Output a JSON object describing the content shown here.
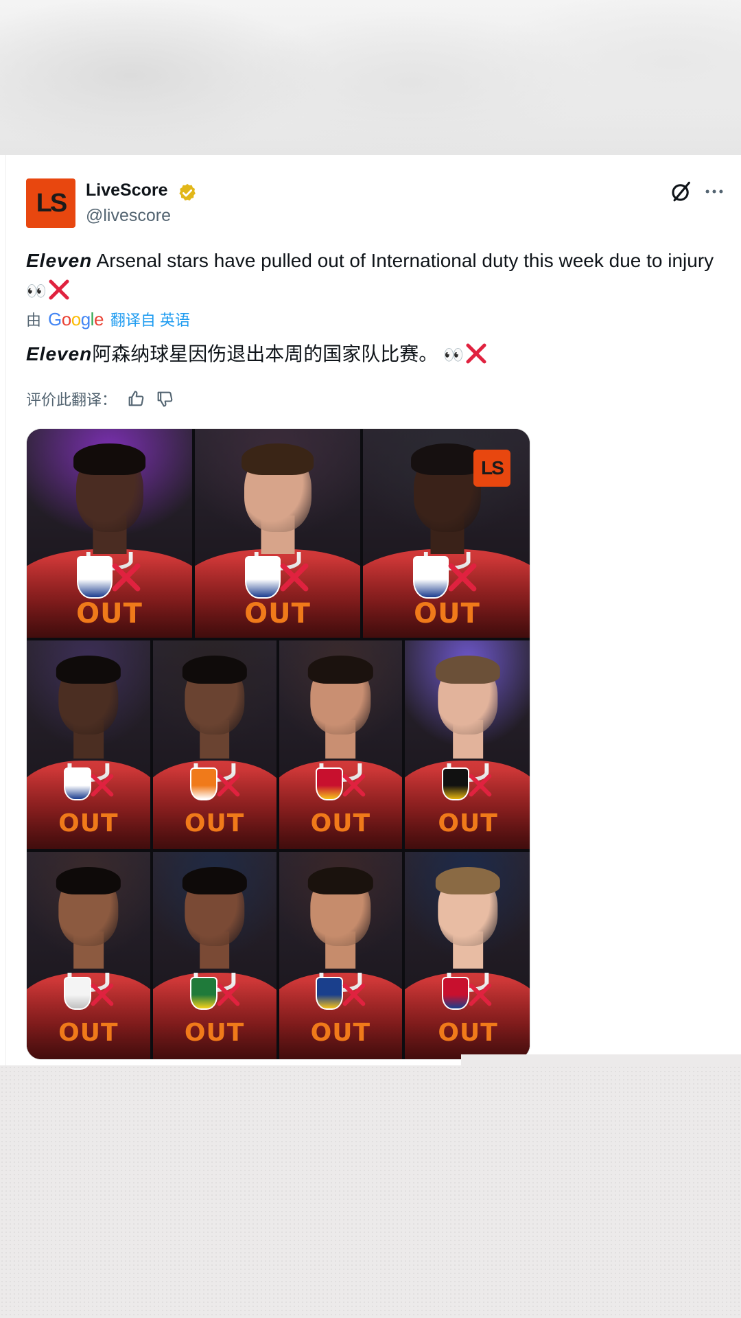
{
  "post": {
    "author": {
      "display_name": "LiveScore",
      "handle": "@livescore",
      "avatar_text": "LS",
      "verified": true
    },
    "text_emphasis": "Eleven",
    "text_body": " Arsenal stars have pulled out of International duty this week due to injury",
    "text_emoji": "👀",
    "translate": {
      "prefix": "由",
      "provider": "Google",
      "link": "翻译自 英语"
    },
    "translated_emphasis": "Eleven",
    "translated_body": "阿森纳球星因伤退出本周的国家队比赛。",
    "translated_emoji": "👀",
    "rate_label": "评价此翻译："
  },
  "media": {
    "logo_text": "LS",
    "rows": [
      [
        {
          "label": "OUT",
          "badge": "england-crest-icon"
        },
        {
          "label": "OUT",
          "badge": "england-crest-icon"
        },
        {
          "label": "OUT",
          "badge": "england-crest-icon"
        }
      ],
      [
        {
          "label": "OUT",
          "badge": "england-crest-icon"
        },
        {
          "label": "OUT",
          "badge": "netherlands-crest-icon"
        },
        {
          "label": "OUT",
          "badge": "spain-crest-icon"
        },
        {
          "label": "OUT",
          "badge": "belgium-crest-icon"
        }
      ],
      [
        {
          "label": "OUT",
          "badge": "france-rooster-icon"
        },
        {
          "label": "OUT",
          "badge": "brazil-crest-icon"
        },
        {
          "label": "OUT",
          "badge": "ecuador-crest-icon"
        },
        {
          "label": "OUT",
          "badge": "norway-crest-icon"
        }
      ]
    ]
  },
  "colors": {
    "accent": "#e8470f",
    "out_label": "#f07a1a",
    "cross": "#e0223f",
    "link": "#1d9bf0",
    "verified": "#e2b719"
  }
}
